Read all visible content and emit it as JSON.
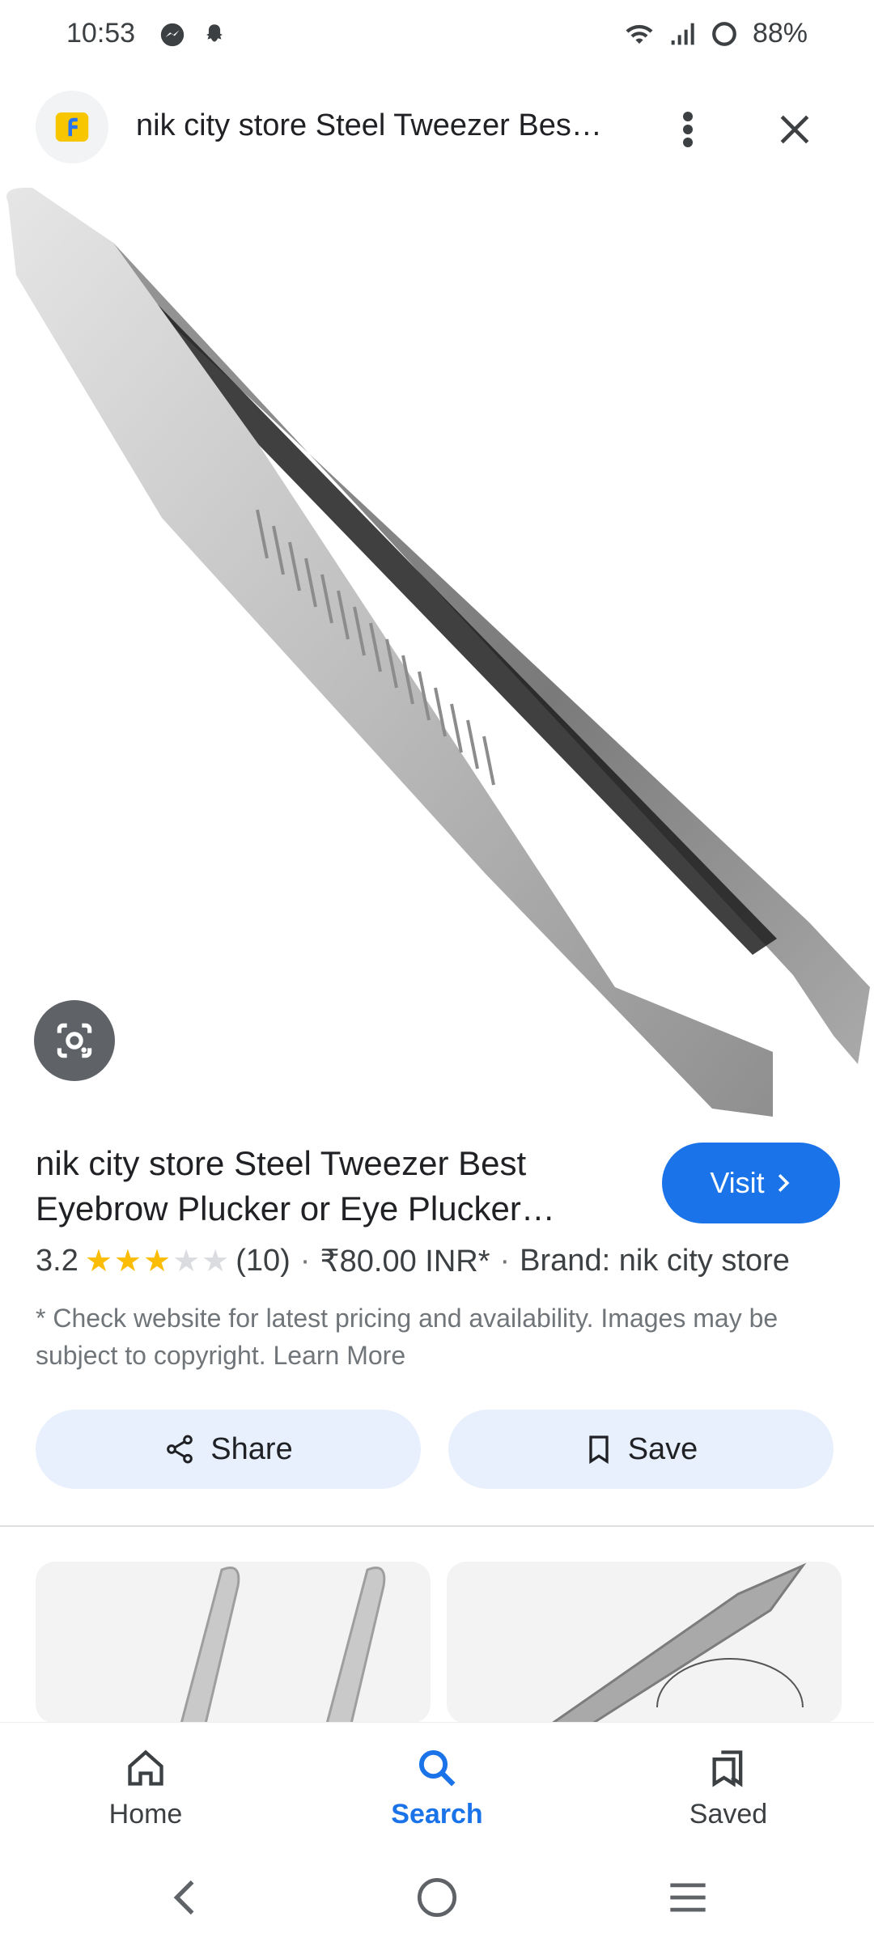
{
  "status_bar": {
    "time": "10:53",
    "battery": "88%"
  },
  "header": {
    "title": "nik city store Steel Tweezer Bes…",
    "app_icon": "flipkart-logo"
  },
  "product": {
    "title": "nik city store Steel Tweezer Best Eyebrow Plucker or Eye Plucker…",
    "visit_label": "Visit",
    "rating": "3.2",
    "rating_value": 3.2,
    "reviews": "(10)",
    "price": "₹80.00 INR*",
    "brand": "Brand: nik city store",
    "disclaimer": "* Check website for latest pricing and availability. Images may be subject to copyright. Learn More"
  },
  "actions": {
    "share_label": "Share",
    "save_label": "Save"
  },
  "bottom_nav": {
    "items": [
      {
        "label": "Home",
        "icon": "home-icon"
      },
      {
        "label": "Search",
        "icon": "search-icon",
        "active": true
      },
      {
        "label": "Saved",
        "icon": "saved-icon"
      }
    ]
  },
  "colors": {
    "accent": "#1a73e8",
    "pill_bg": "#e8f0fe",
    "star": "#fbbc04"
  }
}
